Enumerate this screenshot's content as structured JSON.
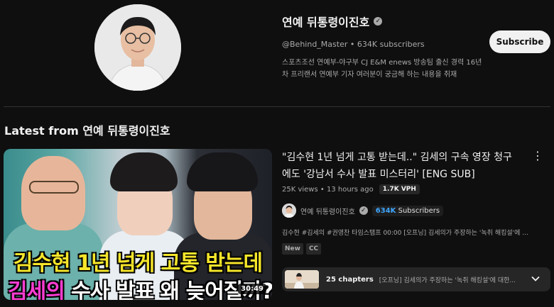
{
  "channel": {
    "name": "연예 뒤통령이진호",
    "handle": "@Behind_Master",
    "subscribers": "634K subscribers",
    "description": "스포츠조선 연예부-야구부 CJ E&M enews 방송팀 출신 경력 16년 차 프리랜서 연예부 기자 여러분이 궁금해 하는 내용을 취재",
    "subscribe_label": "Subscribe"
  },
  "section": {
    "title": "Latest from 연예 뒤통령이진호"
  },
  "video": {
    "title": "\"김수현 1년 넘게 고통 받는데..\" 김세의 구속 영장 청구에도 '강남서 수사 발표 미스터리' [ENG SUB]",
    "views": "25K views",
    "age": "13 hours ago",
    "vph": "1.7K VPH",
    "channel_name": "연예 뒤통령이진호",
    "subs_count": "634K",
    "subs_label": "Subscribers",
    "description": "김수현 #김세의 #권영찬 타임스탬프 00:00 [오프닝] 김세의가 주장하는 '녹취 해킹설'에 ...",
    "duration": "30:49",
    "thumb_caption_1": "김수현 1년 넘게 고통 받는데",
    "thumb_caption_2a": "김세의",
    "thumb_caption_2b": " 수사 발표 왜 늦어질까?",
    "badges": [
      "New",
      "CC"
    ],
    "chapters_count": "25 chapters",
    "chapters_text": "[오프닝] 김세의가 주장하는 '녹취 해킹설'에 대한..."
  },
  "icons": {
    "verified": "verified-check-icon",
    "menu": "more-vert-icon",
    "chevron": "chevron-down-icon"
  },
  "colors": {
    "background": "#0f0f0f",
    "subscribe_bg": "#f1f1f1",
    "subs_accent": "#3ea6ff",
    "caption_yellow": "#f5e52a",
    "caption_magenta": "#ff3dd2"
  }
}
